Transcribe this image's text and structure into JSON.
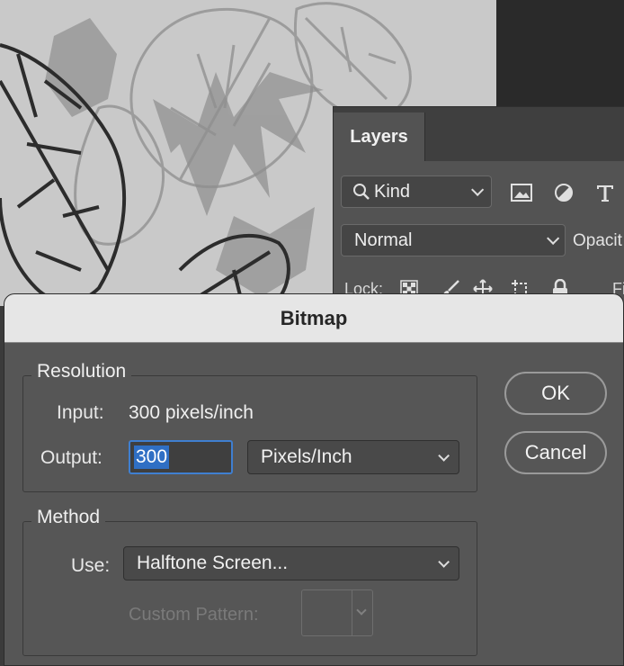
{
  "layers_panel": {
    "tab_label": "Layers",
    "kind_filter": "Kind",
    "filter_icons": [
      "image-filter-icon",
      "adjustment-filter-icon",
      "type-filter-icon"
    ],
    "blend_mode": "Normal",
    "opacity_label": "Opacit",
    "lock_label": "Lock:",
    "lock_icons": [
      "lock-transparent-icon",
      "lock-brush-icon",
      "lock-move-icon",
      "lock-artboard-icon",
      "lock-all-icon"
    ],
    "fill_label": "Fi"
  },
  "dialog": {
    "title": "Bitmap",
    "resolution": {
      "group_label": "Resolution",
      "input_label": "Input:",
      "input_value": "300 pixels/inch",
      "output_label": "Output:",
      "output_value": "300",
      "output_unit": "Pixels/Inch"
    },
    "method": {
      "group_label": "Method",
      "use_label": "Use:",
      "use_value": "Halftone Screen...",
      "custom_pattern_label": "Custom Pattern:"
    },
    "buttons": {
      "ok": "OK",
      "cancel": "Cancel"
    }
  },
  "colors": {
    "dialog_bg": "#565656",
    "titlebar_bg": "#e6e6e6",
    "selection_highlight": "#2f6fc4",
    "focus_ring": "#3f7fd0",
    "canvas_bg": "#c9c9c9"
  }
}
